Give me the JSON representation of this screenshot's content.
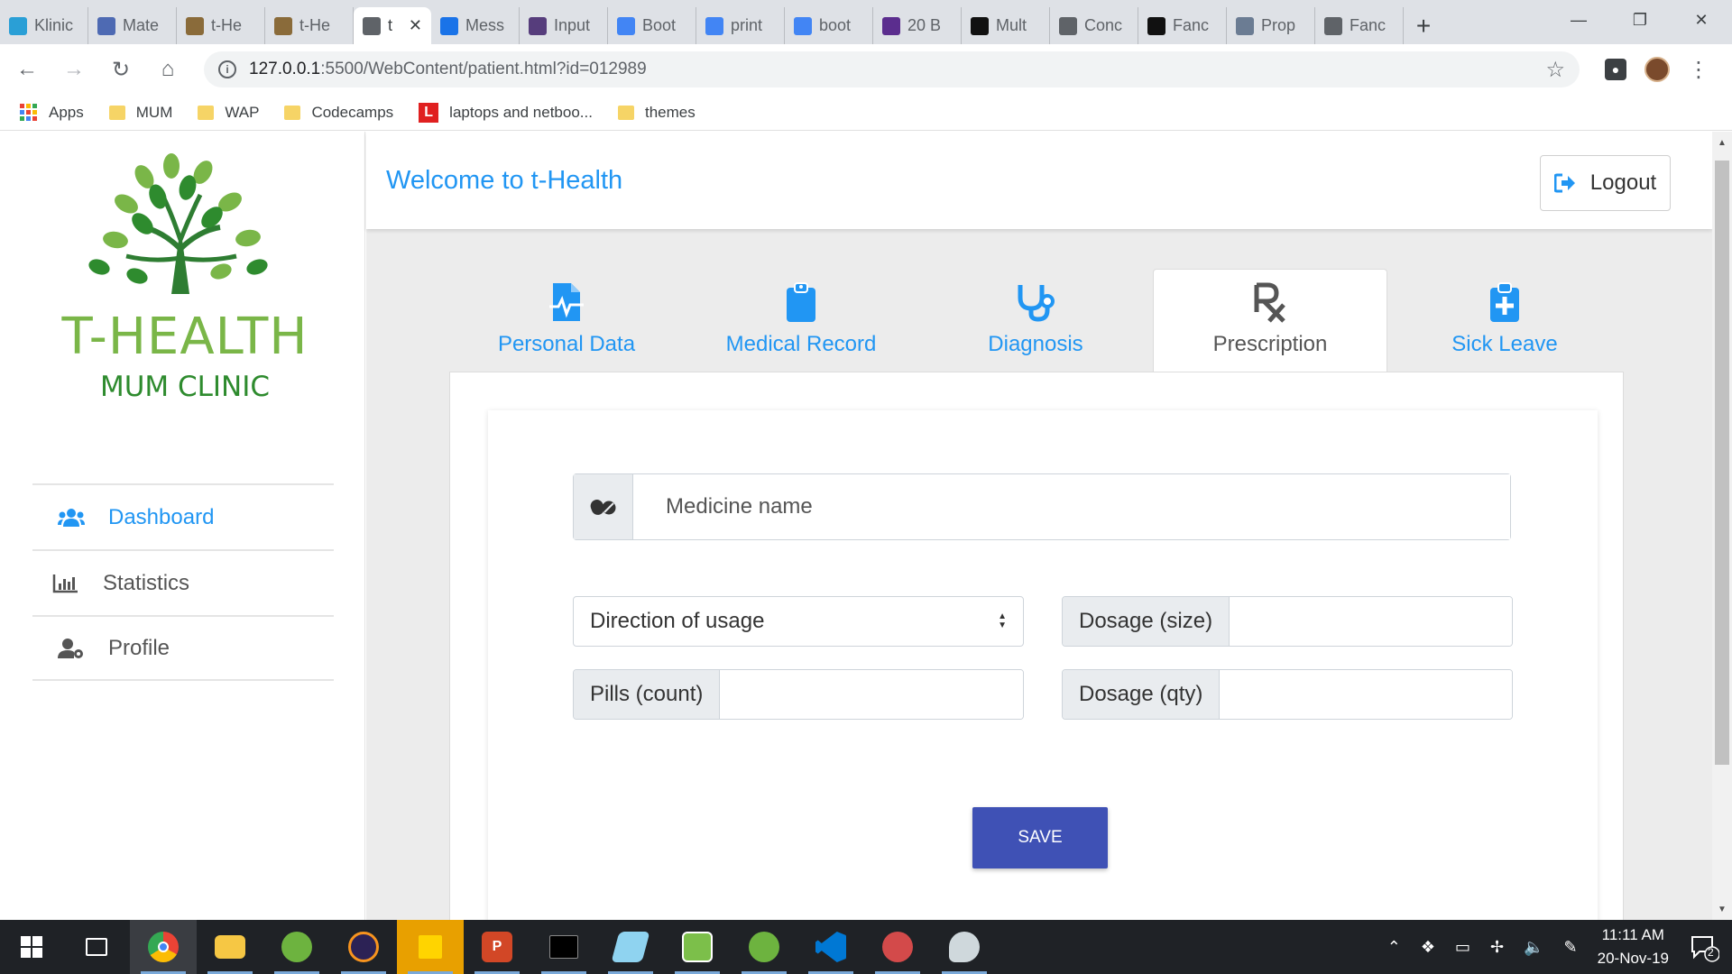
{
  "browser": {
    "tabs": [
      {
        "title": "Klinic",
        "favicon": "klinic-icon",
        "color": "#2a9fd6"
      },
      {
        "title": "Mate",
        "favicon": "materialize-icon",
        "color": "#4e6ab3"
      },
      {
        "title": "t-He",
        "favicon": "t-health-icon",
        "color": "#8a6b3a"
      },
      {
        "title": "t-He",
        "favicon": "t-health-icon",
        "color": "#8a6b3a"
      },
      {
        "title": "t",
        "favicon": "globe-icon",
        "color": "#5f6368",
        "active": true
      },
      {
        "title": "Mess",
        "favicon": "flag-icon",
        "color": "#1a73e8"
      },
      {
        "title": "Input",
        "favicon": "bootstrap-icon",
        "color": "#563d7c"
      },
      {
        "title": "Boot",
        "favicon": "mdb-icon",
        "color": "#4285f4"
      },
      {
        "title": "print",
        "favicon": "google-icon",
        "color": "#4285f4"
      },
      {
        "title": "boot",
        "favicon": "google-icon",
        "color": "#4285f4"
      },
      {
        "title": "20 B",
        "favicon": "colorlib-icon",
        "color": "#5b2d8e"
      },
      {
        "title": "Mult",
        "favicon": "codepen-icon",
        "color": "#111111"
      },
      {
        "title": "Conc",
        "favicon": "wordpress-icon",
        "color": "#5f6368"
      },
      {
        "title": "Fanc",
        "favicon": "codepen-icon",
        "color": "#111111"
      },
      {
        "title": "Prop",
        "favicon": "avatar-icon",
        "color": "#6b7c93"
      },
      {
        "title": "Fanc",
        "favicon": "globe-icon",
        "color": "#5f6368"
      }
    ],
    "url_host": "127.0.0.1",
    "url_path": ":5500/WebContent/patient.html?id=012989",
    "bookmarks": [
      {
        "label": "Apps",
        "type": "apps"
      },
      {
        "label": "MUM",
        "type": "folder"
      },
      {
        "label": "WAP",
        "type": "folder"
      },
      {
        "label": "Codecamps",
        "type": "folder"
      },
      {
        "label": "laptops and netboo...",
        "type": "site"
      },
      {
        "label": "themes",
        "type": "folder"
      }
    ]
  },
  "sidebar": {
    "logo_title": "T-HEALTH",
    "logo_subtitle": "MUM CLINIC",
    "menu": [
      {
        "label": "Dashboard",
        "icon": "users-icon",
        "active": true
      },
      {
        "label": "Statistics",
        "icon": "bar-chart-icon",
        "active": false
      },
      {
        "label": "Profile",
        "icon": "user-gear-icon",
        "active": false
      }
    ]
  },
  "header": {
    "welcome": "Welcome to t-Health",
    "logout_label": "Logout"
  },
  "patient_tabs": [
    {
      "label": "Personal Data",
      "icon": "file-medical-icon",
      "active": false
    },
    {
      "label": "Medical Record",
      "icon": "clipboard-icon",
      "active": false
    },
    {
      "label": "Diagnosis",
      "icon": "stethoscope-icon",
      "active": false
    },
    {
      "label": "Prescription",
      "icon": "prescription-icon",
      "active": true
    },
    {
      "label": "Sick Leave",
      "icon": "clipboard-plus-icon",
      "active": false
    }
  ],
  "form": {
    "medicine_placeholder": "Medicine name",
    "direction_label": "Direction of usage",
    "dosage_size_label": "Dosage (size)",
    "pills_count_label": "Pills (count)",
    "dosage_qty_label": "Dosage (qty)",
    "save_label": "SAVE"
  },
  "taskbar": {
    "time": "11:11 AM",
    "date": "20-Nov-19",
    "notification_count": "2"
  },
  "colors": {
    "accent": "#2196f3",
    "save_button": "#3f51b5",
    "logo_light_green": "#7ab648",
    "logo_dark_green": "#2e8b2e"
  }
}
